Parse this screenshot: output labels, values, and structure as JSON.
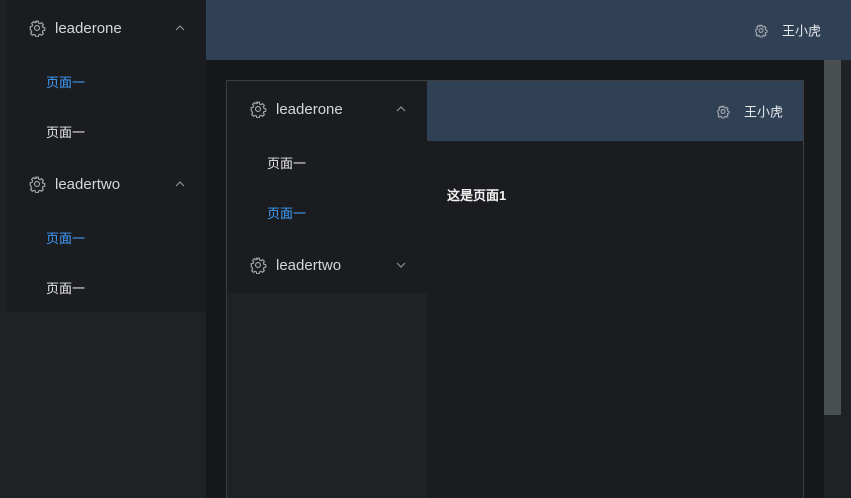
{
  "outer": {
    "sidebar": {
      "groups": [
        {
          "label": "leaderone",
          "expanded": true,
          "items": [
            {
              "label": "页面一",
              "active": true
            },
            {
              "label": "页面一",
              "active": false
            }
          ]
        },
        {
          "label": "leadertwo",
          "expanded": true,
          "items": [
            {
              "label": "页面一",
              "active": true
            },
            {
              "label": "页面一",
              "active": false
            }
          ]
        }
      ]
    },
    "header": {
      "username": "王小虎"
    }
  },
  "inner": {
    "sidebar": {
      "groups": [
        {
          "label": "leaderone",
          "expanded": true,
          "items": [
            {
              "label": "页面一",
              "active": false
            },
            {
              "label": "页面一",
              "active": true
            }
          ]
        },
        {
          "label": "leadertwo",
          "expanded": false,
          "items": []
        }
      ]
    },
    "header": {
      "username": "王小虎"
    },
    "main": {
      "heading": "这是页面1"
    }
  },
  "icons": {
    "menu_group": "gear-icon",
    "expanded": "chevron-up-icon",
    "collapsed": "chevron-down-icon",
    "user": "gear-icon"
  },
  "colors": {
    "active": "#409eff",
    "header_bg": "#304156",
    "sidebar_bg": "#1b1c1f"
  }
}
